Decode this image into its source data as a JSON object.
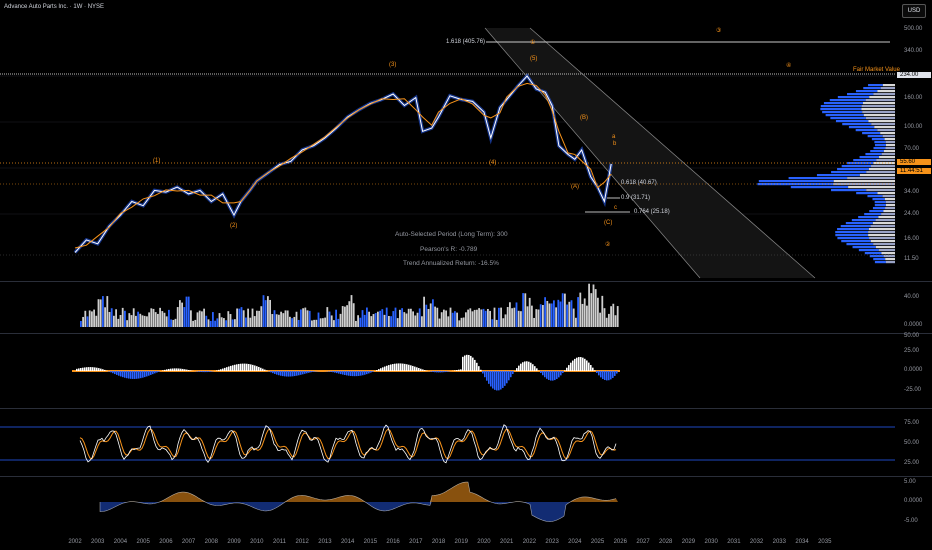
{
  "header": {
    "title": "Advance Auto Parts Inc. · 1W · NYSE",
    "currency_button": "USD"
  },
  "colors": {
    "orange": "#f7931a",
    "blue": "#2962ff",
    "white": "#ffffff",
    "grid": "#2a2e39"
  },
  "price_axis": {
    "ticks": [
      "500.00",
      "340.00",
      "234.00",
      "160.00",
      "100.00",
      "70.00",
      "55.60",
      "34.00",
      "24.00",
      "16.00",
      "11.50"
    ],
    "current_price": "55.60",
    "countdown": "11:44:51",
    "fair_value_tag": "234.00"
  },
  "annotations": {
    "fib_1618": "1.618 (405.76)",
    "fib_0618": "0.618 (40.67)",
    "fib_09": "0.9 (31.71)",
    "fib_0764": "0.764 (25.18)",
    "fair_market_value": "Fair Market Value",
    "waves": {
      "w1": "(1)",
      "w2": "(2)",
      "w3": "(3)",
      "w4": "(4)",
      "w5": "(5)",
      "wA": "(A)",
      "wB": "(B)",
      "wC": "(C)",
      "c1": "①",
      "c2": "②",
      "c3": "③",
      "c4": "④",
      "a_small": "a",
      "b_small": "b",
      "c_small": "c"
    },
    "stats": {
      "period": "Auto-Selected Period (Long Term): 300",
      "pearson": "Pearson's R: -0.789",
      "trend_return": "Trend Annualized Return: -16.5%"
    }
  },
  "indicator_axes": {
    "volume": [
      "40.00",
      "0.0000"
    ],
    "osc1": [
      "50.00",
      "25.00",
      "0.0000",
      "-25.00"
    ],
    "rsi": [
      "75.00",
      "50.00",
      "25.00"
    ],
    "osc2": [
      "5.00",
      "0.0000",
      "-5.00"
    ]
  },
  "chart_data": {
    "type": "line",
    "title": "Advance Auto Parts Inc. · 1W · NYSE",
    "y_scale": "log",
    "ylim": [
      11.5,
      500
    ],
    "x_ticks": [
      "2002",
      "2003",
      "2004",
      "2005",
      "2006",
      "2007",
      "2008",
      "2009",
      "2010",
      "2011",
      "2012",
      "2013",
      "2014",
      "2015",
      "2016",
      "2017",
      "2018",
      "2019",
      "2020",
      "2021",
      "2022",
      "2023",
      "2024",
      "2025",
      "2026",
      "2027",
      "2028",
      "2029",
      "2030",
      "2031",
      "2032",
      "2033",
      "2034",
      "2035"
    ],
    "series": [
      {
        "x": [
          2002.0,
          2002.5,
          2003.0,
          2003.5,
          2004.0,
          2004.5,
          2005.0,
          2005.5,
          2006.0,
          2006.5,
          2007.0,
          2007.5,
          2008.0,
          2008.5,
          2009.0,
          2009.3,
          2009.7,
          2010.0,
          2010.5,
          2011.0,
          2011.5,
          2012.0,
          2012.5,
          2013.0,
          2013.5,
          2014.0,
          2014.5,
          2015.0,
          2015.5,
          2016.0,
          2016.5,
          2017.0,
          2017.3,
          2017.7,
          2018.0,
          2018.5,
          2019.0,
          2019.5,
          2020.0,
          2020.3,
          2020.7,
          2021.0,
          2021.5,
          2021.9,
          2022.3,
          2022.7,
          2023.0,
          2023.3,
          2023.7,
          2024.0,
          2024.3,
          2024.7,
          2025.0,
          2025.3,
          2025.6
        ],
        "values": [
          13,
          16,
          15,
          20,
          24,
          30,
          28,
          36,
          35,
          38,
          34,
          36,
          30,
          34,
          24,
          30,
          36,
          42,
          48,
          55,
          58,
          70,
          75,
          85,
          100,
          120,
          135,
          150,
          160,
          175,
          145,
          165,
          95,
          100,
          120,
          170,
          160,
          155,
          130,
          85,
          140,
          160,
          200,
          235,
          190,
          180,
          145,
          75,
          65,
          60,
          70,
          45,
          38,
          30,
          55.6
        ]
      }
    ],
    "volume_max": 40,
    "rsi_levels": [
      75,
      50,
      25
    ]
  }
}
